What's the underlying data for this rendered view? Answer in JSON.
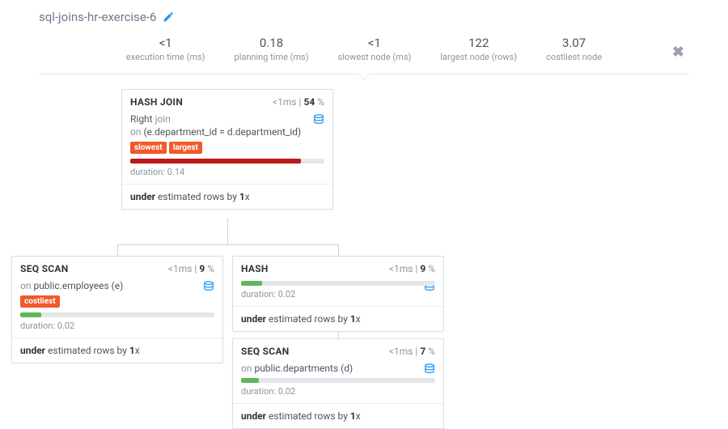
{
  "header": {
    "title": "sql-joins-hr-exercise-6"
  },
  "stats": {
    "exec_time_value": "<1",
    "exec_time_label": "execution time (ms)",
    "plan_time_value": "0.18",
    "plan_time_label": "planning time (ms)",
    "slowest_value": "<1",
    "slowest_label": "slowest node (ms)",
    "largest_value": "122",
    "largest_label": "largest node (rows)",
    "costliest_value": "3.07",
    "costliest_label": "costliest node"
  },
  "nodes": {
    "hash_join": {
      "title": "HASH JOIN",
      "time": "<1",
      "pct": "54",
      "desc_prefix": "Right",
      "desc_mid": " join",
      "desc_on": "on ",
      "desc_cond": "(e.department_id = d.department_id)",
      "tag_slowest": "slowest",
      "tag_largest": "largest",
      "duration_label": "duration: ",
      "duration_value": "0.14",
      "footer_prefix": "under",
      "footer_mid": " estimated rows by ",
      "footer_val": "1",
      "footer_suffix": "x"
    },
    "seq_emp": {
      "title": "SEQ SCAN",
      "time": "<1",
      "pct": "9",
      "desc_on": "on ",
      "desc_rel": "public.employees (e)",
      "tag_costliest": "costliest",
      "duration_label": "duration: ",
      "duration_value": "0.02",
      "footer_prefix": "under",
      "footer_mid": " estimated rows by ",
      "footer_val": "1",
      "footer_suffix": "x"
    },
    "hash": {
      "title": "HASH",
      "time": "<1",
      "pct": "9",
      "duration_label": "duration: ",
      "duration_value": "0.02",
      "footer_prefix": "under",
      "footer_mid": " estimated rows by ",
      "footer_val": "1",
      "footer_suffix": "x"
    },
    "seq_dep": {
      "title": "SEQ SCAN",
      "time": "<1",
      "pct": "7",
      "desc_on": "on ",
      "desc_rel": "public.departments (d)",
      "duration_label": "duration: ",
      "duration_value": "0.02",
      "footer_prefix": "under",
      "footer_mid": " estimated rows by ",
      "footer_val": "1",
      "footer_suffix": "x"
    }
  }
}
